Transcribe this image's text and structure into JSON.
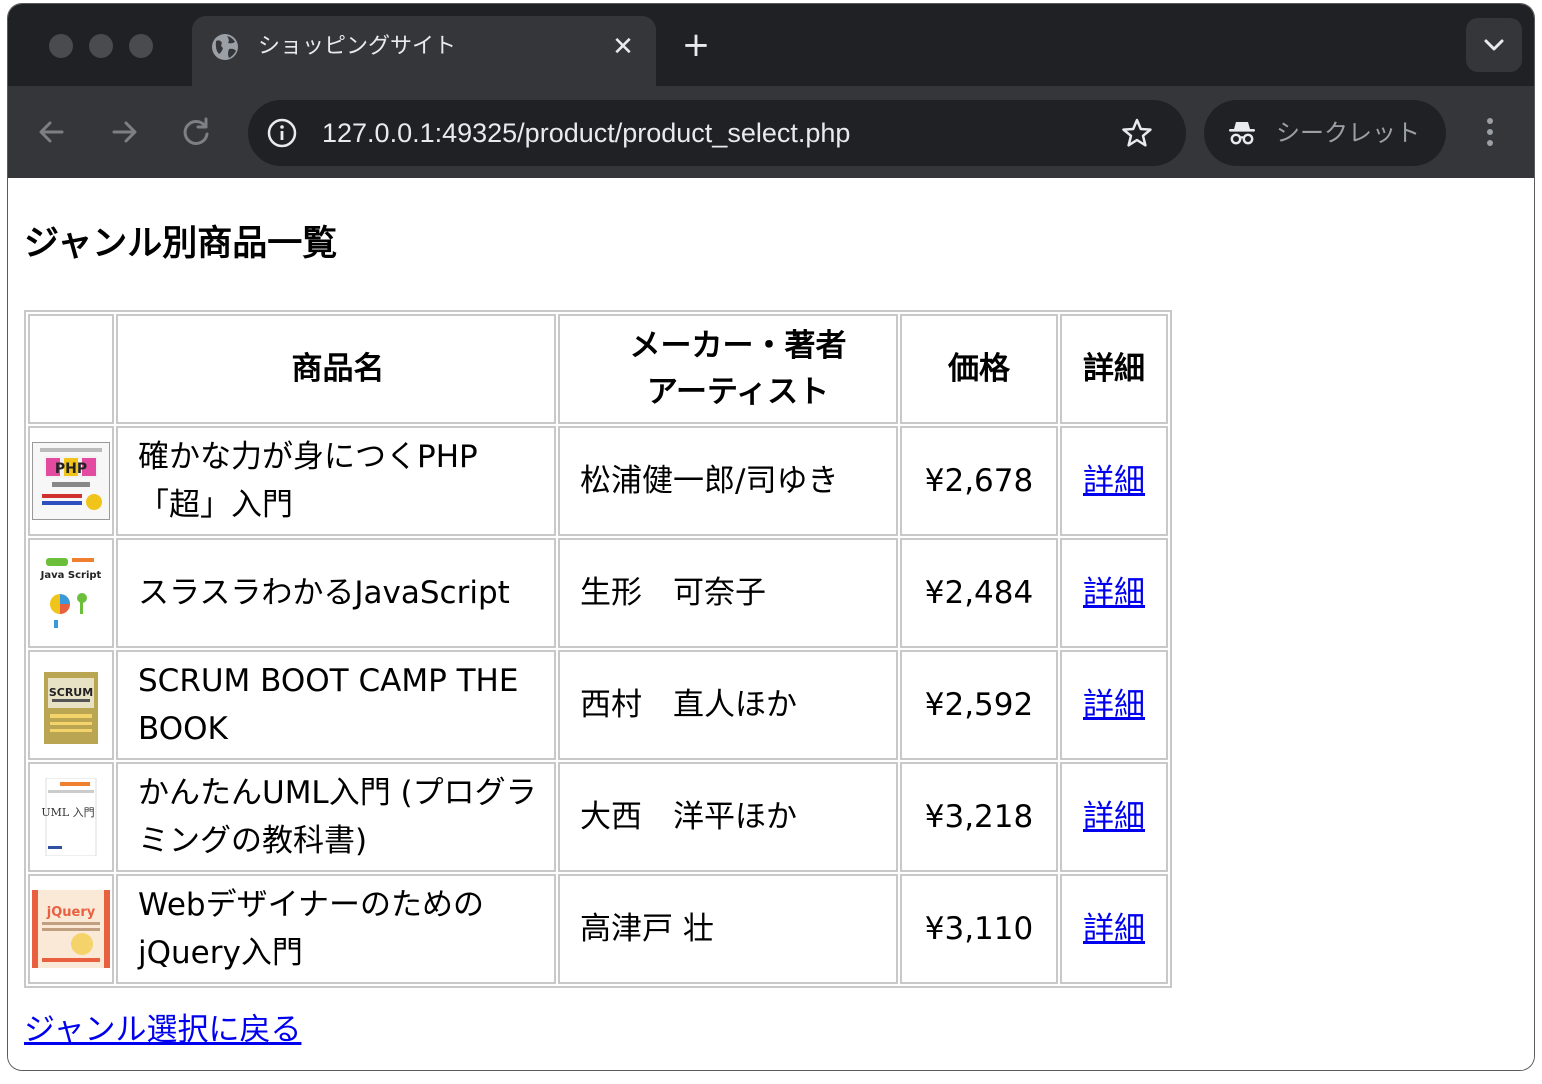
{
  "browser": {
    "tab_title": "ショッピングサイト",
    "url": "127.0.0.1:49325/product/product_select.php",
    "incognito_label": "シークレット"
  },
  "page": {
    "heading": "ジャンル別商品一覧",
    "columns": {
      "image": "",
      "name": "商品名",
      "maker_line1": "メーカー・著者",
      "maker_line2": "アーティスト",
      "price": "価格",
      "detail": "詳細"
    },
    "products": [
      {
        "name": "確かな力が身につくPHP「超」入門",
        "maker": "松浦健一郎/司ゆき",
        "price": "¥2,678",
        "detail_link": "詳細",
        "cover_text": "PHP"
      },
      {
        "name": "スラスラわかるJavaScript",
        "maker": "生形　可奈子",
        "price": "¥2,484",
        "detail_link": "詳細",
        "cover_text": "Java Script"
      },
      {
        "name": "SCRUM BOOT CAMP THE BOOK",
        "maker": "西村　直人ほか",
        "price": "¥2,592",
        "detail_link": "詳細",
        "cover_text": "SCRUM"
      },
      {
        "name": "かんたんUML入門 (プログラミングの教科書)",
        "maker": "大西　洋平ほか",
        "price": "¥3,218",
        "detail_link": "詳細",
        "cover_text": "UML 入門"
      },
      {
        "name": "Webデザイナーのための jQuery入門",
        "maker": "高津戸 壮",
        "price": "¥3,110",
        "detail_link": "詳細",
        "cover_text": "jQuery"
      }
    ],
    "back_link": "ジャンル選択に戻る"
  }
}
